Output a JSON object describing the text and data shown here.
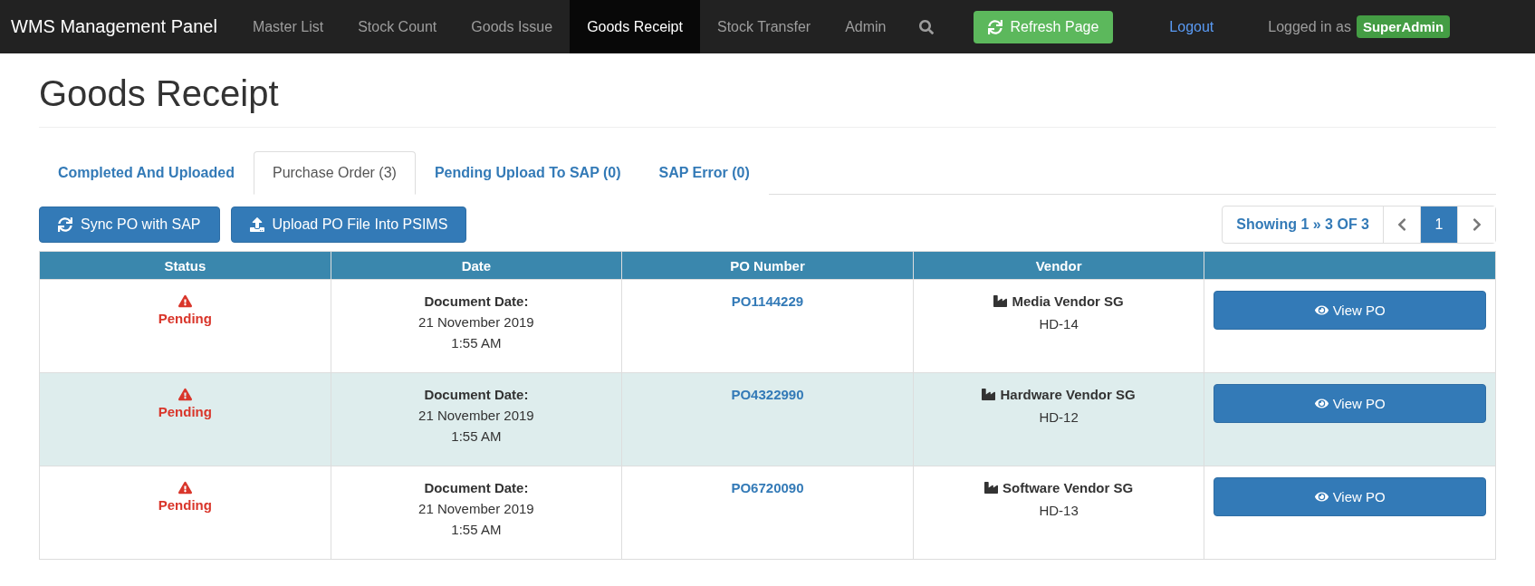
{
  "navbar": {
    "brand": "WMS Management Panel",
    "items": [
      {
        "label": "Master List",
        "selected": false
      },
      {
        "label": "Stock Count",
        "selected": false
      },
      {
        "label": "Goods Issue",
        "selected": false
      },
      {
        "label": "Goods Receipt",
        "selected": true
      },
      {
        "label": "Stock Transfer",
        "selected": false
      },
      {
        "label": "Admin",
        "selected": false
      }
    ],
    "refresh_button": "Refresh Page",
    "logout": "Logout",
    "logged_in_text": "Logged in as",
    "user_badge": "SuperAdmin"
  },
  "page_title": "Goods Receipt",
  "tabs": [
    {
      "label": "Completed And Uploaded",
      "selected": false
    },
    {
      "label": "Purchase Order (3)",
      "selected": true
    },
    {
      "label": "Pending Upload To SAP (0)",
      "selected": false
    },
    {
      "label": "SAP Error (0)",
      "selected": false
    }
  ],
  "toolbar": {
    "buttons": [
      {
        "kind": "sync",
        "label": "Sync PO with SAP"
      },
      {
        "kind": "upload",
        "label": "Upload PO File Into PSIMS"
      }
    ]
  },
  "pagination": {
    "summary": "Showing 1 » 3 OF 3",
    "pages": [
      {
        "label": "1",
        "selected": true
      }
    ]
  },
  "table": {
    "columns": [
      "Status",
      "Date",
      "PO Number",
      "Vendor"
    ],
    "rows": [
      {
        "status": "Pending",
        "date_label": "Document Date:",
        "date": "21 November 2019",
        "time": "1:55 AM",
        "po_number": "PO1144229",
        "vendor": "Media Vendor SG",
        "vendor_code": "HD-14",
        "action": "View PO",
        "highlighted": false
      },
      {
        "status": "Pending",
        "date_label": "Document Date:",
        "date": "21 November 2019",
        "time": "1:55 AM",
        "po_number": "PO4322990",
        "vendor": "Hardware Vendor SG",
        "vendor_code": "HD-12",
        "action": "View PO",
        "highlighted": true
      },
      {
        "status": "Pending",
        "date_label": "Document Date:",
        "date": "21 November 2019",
        "time": "1:55 AM",
        "po_number": "PO6720090",
        "vendor": "Software Vendor SG",
        "vendor_code": "HD-13",
        "action": "View PO",
        "highlighted": false
      }
    ]
  }
}
